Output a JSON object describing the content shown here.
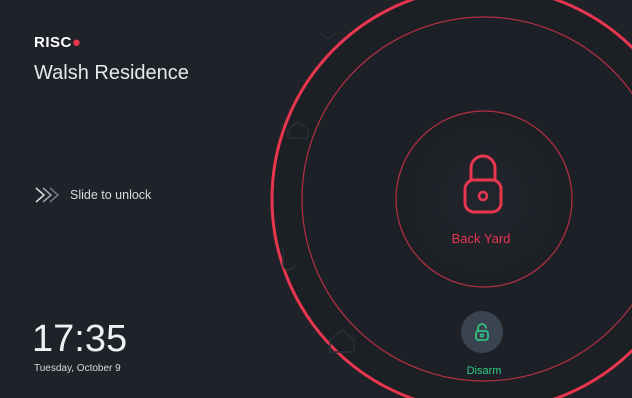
{
  "brand": {
    "logo_text": "RISC",
    "logo_mark": "•"
  },
  "panel": {
    "residence_name": "Walsh Residence",
    "slide_to_unlock": "Slide to unlock",
    "time": "17:35",
    "date": "Tuesday, October 9"
  },
  "zone": {
    "name": "Back Yard",
    "state_icon": "lock-closed-icon",
    "color": "#e8364f"
  },
  "action": {
    "label": "Disarm",
    "icon": "lock-open-icon",
    "color": "#2fcf87"
  },
  "colors": {
    "background": "#1f2228",
    "accent_red": "#e8364f",
    "accent_green": "#2fcf87"
  }
}
